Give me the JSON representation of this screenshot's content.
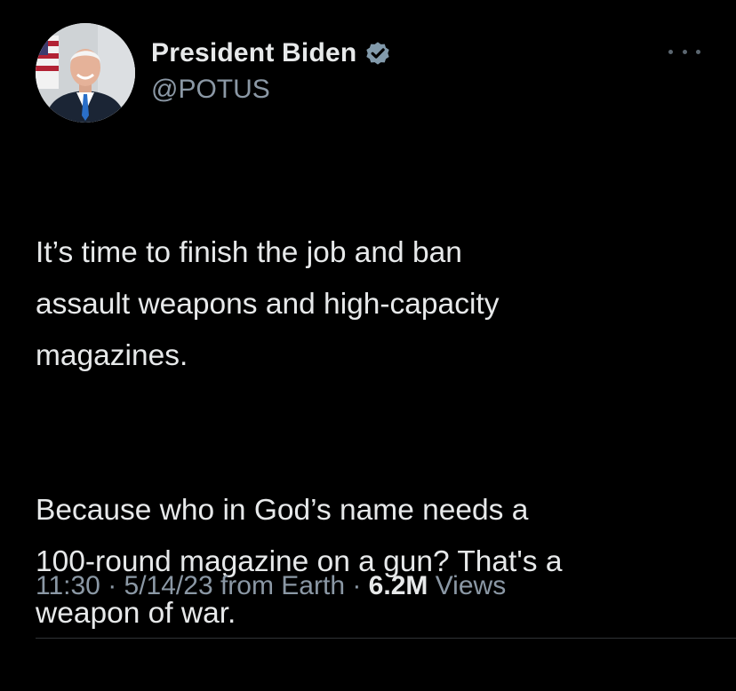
{
  "author": {
    "display_name": "President Biden",
    "handle": "@POTUS",
    "verified_icon": "verified-badge-icon",
    "avatar_icon": "profile-photo-avatar"
  },
  "more_icon": "more-options-icon",
  "tweet": {
    "paragraphs": [
      "It’s time to finish the job and ban\nassault weapons and high-capacity\nmagazines.",
      "Because who in God’s name needs a\n100-round magazine on a gun? That's a\nweapon of war."
    ]
  },
  "meta": {
    "time": "11:30",
    "sep1": " · ",
    "date": "5/14/23",
    "source": " from Earth",
    "sep2": " · ",
    "views_count": "6.2M",
    "views_label": " Views"
  },
  "colors": {
    "background": "#000000",
    "text": "#e7e9ea",
    "secondary_text": "#8b98a5",
    "verified": "#829aab"
  }
}
